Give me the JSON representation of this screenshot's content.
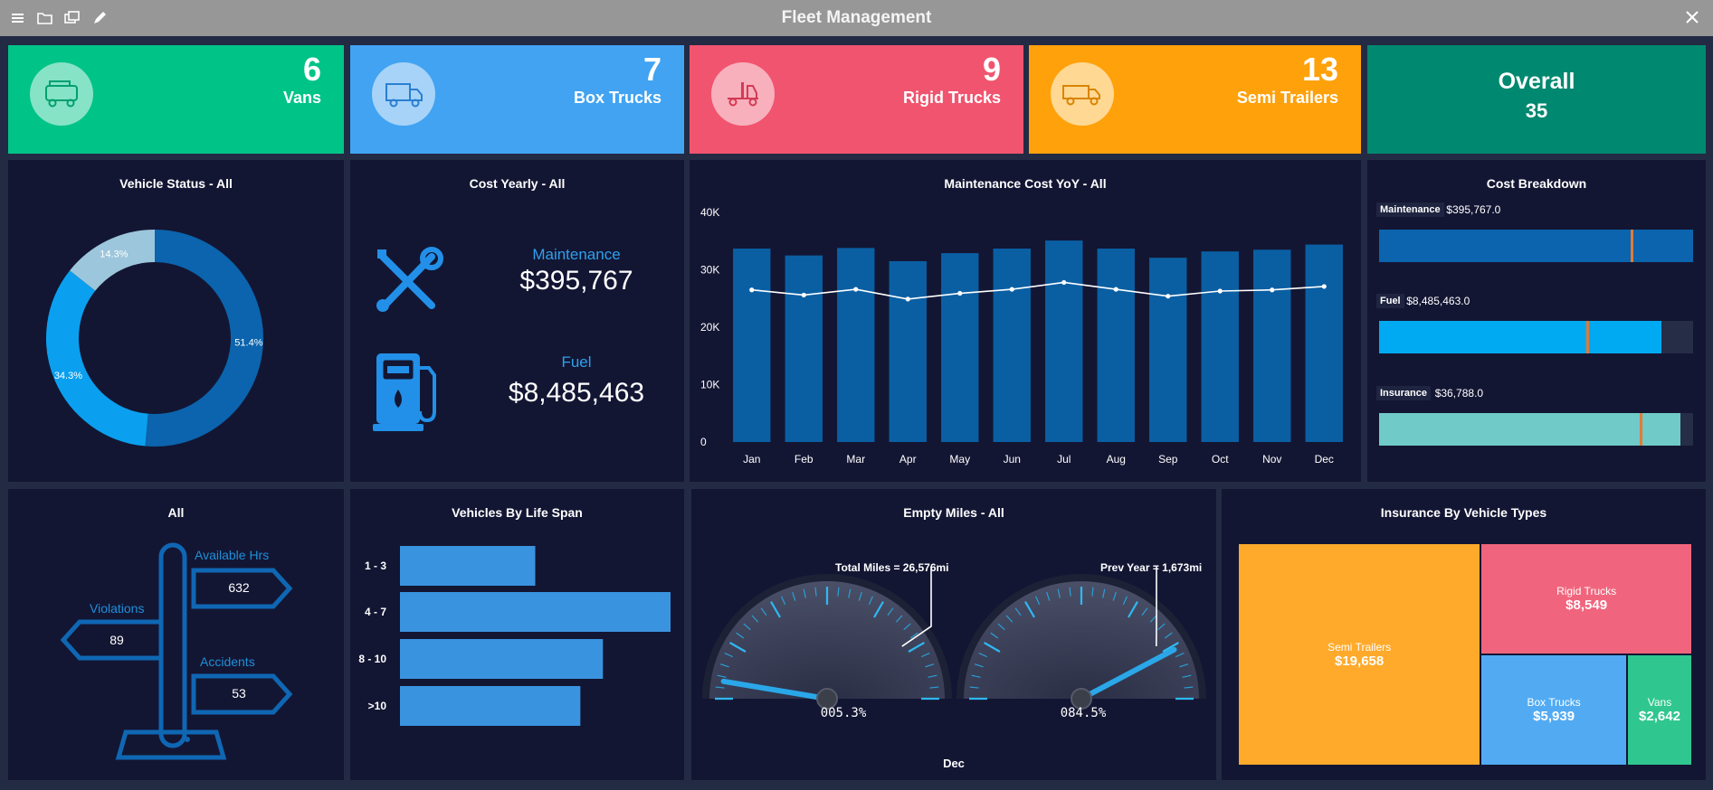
{
  "window": {
    "title": "Fleet Management"
  },
  "kpis": [
    {
      "value": "6",
      "label": "Vans",
      "color": "#00c387",
      "icon": "van-icon"
    },
    {
      "value": "7",
      "label": "Box Trucks",
      "color": "#41a3f2",
      "icon": "box-truck-icon"
    },
    {
      "value": "9",
      "label": "Rigid Trucks",
      "color": "#f1546f",
      "icon": "rigid-truck-icon"
    },
    {
      "value": "13",
      "label": "Semi Trailers",
      "color": "#ffa10a",
      "icon": "semi-trailer-icon"
    }
  ],
  "overall": {
    "label": "Overall",
    "value": "35"
  },
  "vehicle_status": {
    "title": "Vehicle Status - All",
    "chart_data": {
      "type": "pie",
      "slices": [
        {
          "label": "51.4%",
          "value": 51.4,
          "color": "#0b64ad"
        },
        {
          "label": "34.3%",
          "value": 34.3,
          "color": "#0aa0ef"
        },
        {
          "label": "14.3%",
          "value": 14.3,
          "color": "#9cc6db"
        }
      ]
    }
  },
  "cost_yearly": {
    "title": "Cost Yearly - All",
    "maintenance_label": "Maintenance",
    "maintenance_value": "$395,767",
    "fuel_label": "Fuel",
    "fuel_value": "$8,485,463"
  },
  "maintenance_yoy": {
    "title": "Maintenance Cost YoY - All",
    "chart_data": {
      "type": "bar",
      "categories": [
        "Jan",
        "Feb",
        "Mar",
        "Apr",
        "May",
        "Jun",
        "Jul",
        "Aug",
        "Sep",
        "Oct",
        "Nov",
        "Dec"
      ],
      "series": [
        {
          "type": "bar",
          "values": [
            33700,
            32500,
            33800,
            31500,
            32900,
            33700,
            35100,
            33700,
            32100,
            33200,
            33500,
            34400
          ]
        },
        {
          "type": "line",
          "values": [
            26500,
            25600,
            26600,
            24900,
            25900,
            26600,
            27800,
            26600,
            25400,
            26300,
            26500,
            27100
          ]
        }
      ],
      "yticks": [
        "0",
        "10K",
        "20K",
        "30K",
        "40K"
      ],
      "ylim": [
        0,
        40000
      ]
    }
  },
  "cost_breakdown": {
    "title": "Cost Breakdown",
    "items": [
      {
        "label": "Maintenance",
        "value": "$395,767.0",
        "fill": 1.0,
        "marker": 0.8,
        "color": "#0b64ad"
      },
      {
        "label": "Fuel",
        "value": "$8,485,463.0",
        "fill": 0.9,
        "marker": 0.66,
        "color": "#00aaf2"
      },
      {
        "label": "Insurance",
        "value": "$36,788.0",
        "fill": 0.96,
        "marker": 0.83,
        "color": "#6fcac8"
      }
    ]
  },
  "signpost": {
    "title": "All",
    "available_label": "Available Hrs",
    "available_value": "632",
    "violations_label": "Violations",
    "violations_value": "89",
    "accidents_label": "Accidents",
    "accidents_value": "53"
  },
  "life_span": {
    "title": "Vehicles By Life Span",
    "chart_data": {
      "type": "bar",
      "orientation": "horizontal",
      "categories": [
        "1 - 3",
        "4 - 7",
        "8 - 10",
        ">10"
      ],
      "values": [
        3,
        6,
        4.5,
        4
      ],
      "xlim": [
        0,
        6
      ]
    }
  },
  "empty_miles": {
    "title": "Empty Miles - All",
    "gauge1_label": "Total Miles = 26,576mi",
    "gauge1_readout": "005.3%",
    "gauge1_value": 5.3,
    "gauge2_label": "Prev Year = 1,673mi",
    "gauge2_readout": "084.5%",
    "gauge2_value": 84.5,
    "footer": "Dec"
  },
  "insurance": {
    "title": "Insurance By Vehicle Types",
    "chart_data": {
      "type": "treemap",
      "items": [
        {
          "label": "Semi Trailers",
          "value": "$19,658",
          "color": "#ffaa2b"
        },
        {
          "label": "Rigid Trucks",
          "value": "$8,549",
          "color": "#f0657d"
        },
        {
          "label": "Box Trucks",
          "value": "$5,939",
          "color": "#52abf2"
        },
        {
          "label": "Vans",
          "value": "$2,642",
          "color": "#2fc78f"
        }
      ]
    }
  }
}
